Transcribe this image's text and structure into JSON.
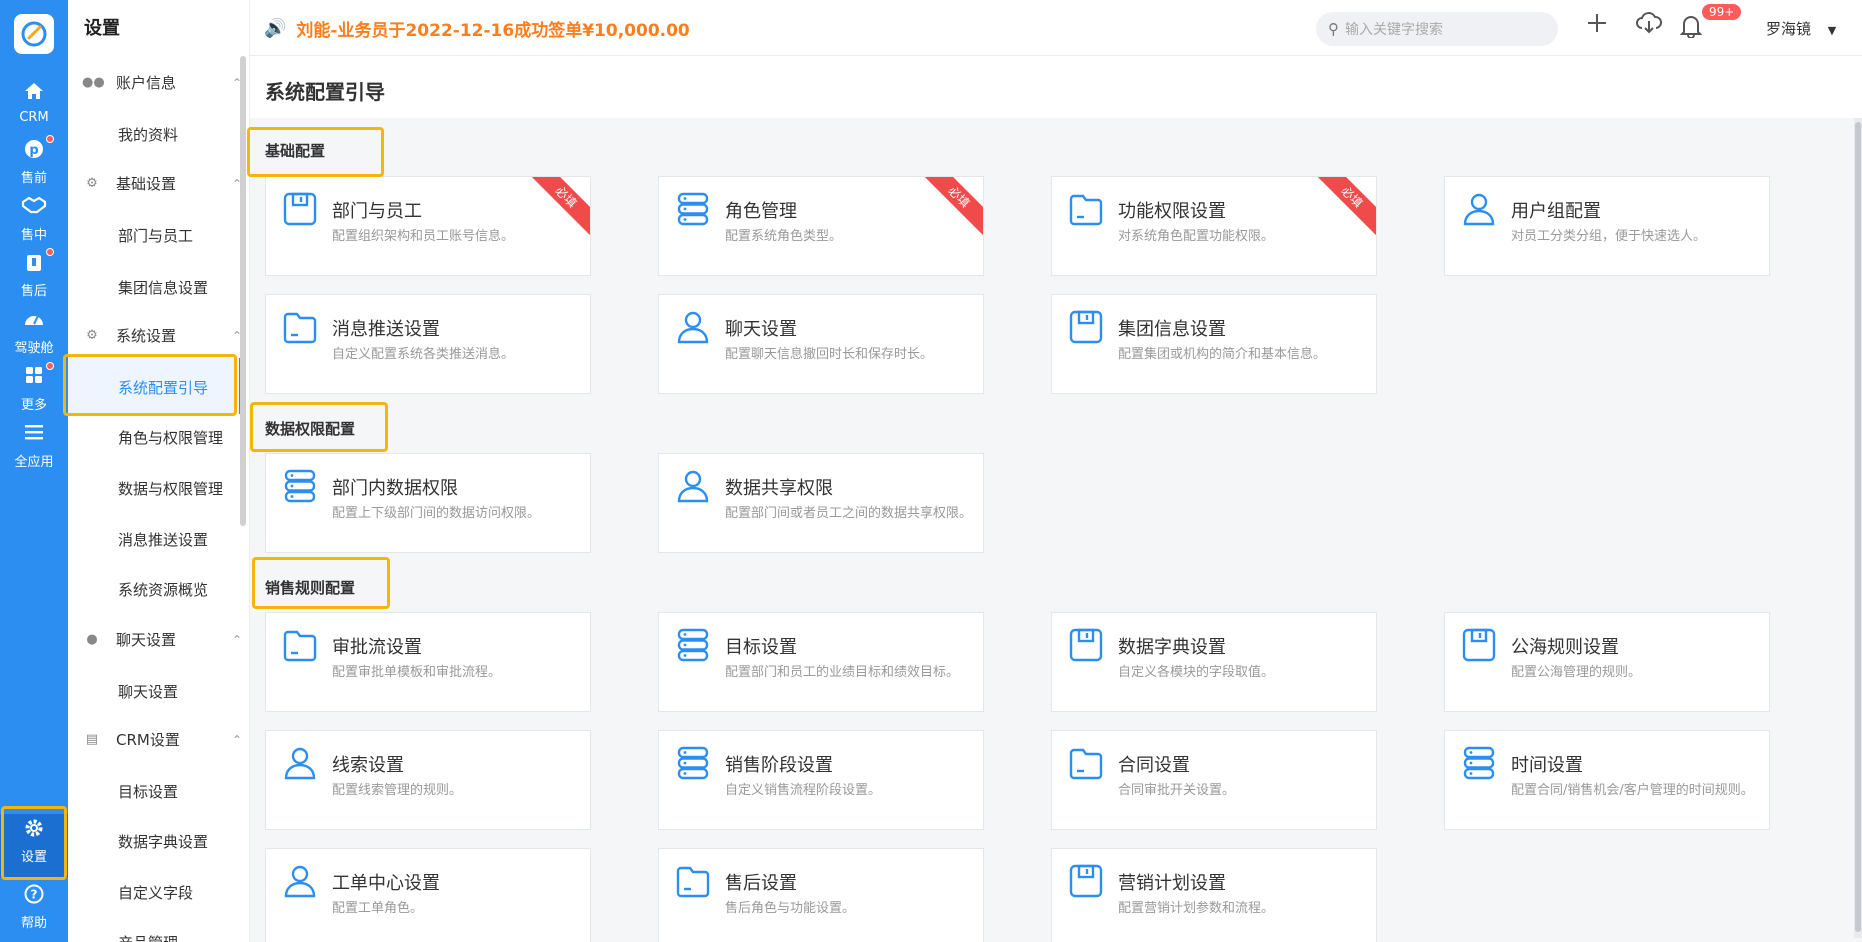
{
  "rail": {
    "items": [
      {
        "label": "CRM",
        "icon": "home-icon",
        "dot": false
      },
      {
        "label": "售前",
        "icon": "pin-icon",
        "dot": true
      },
      {
        "label": "售中",
        "icon": "handshake-icon",
        "dot": false
      },
      {
        "label": "售后",
        "icon": "headset-icon",
        "dot": true
      },
      {
        "label": "驾驶舱",
        "icon": "dashboard-icon",
        "dot": false
      },
      {
        "label": "更多",
        "icon": "grid-icon",
        "dot": true
      },
      {
        "label": "全应用",
        "icon": "menu-icon",
        "dot": false
      },
      {
        "label": "设置",
        "icon": "gear-icon",
        "dot": false
      },
      {
        "label": "帮助",
        "icon": "help-icon",
        "dot": false
      }
    ]
  },
  "sidebar": {
    "title": "设置",
    "groups": {
      "account": "账户信息",
      "basic": "基础设置",
      "system": "系统设置",
      "chat": "聊天设置",
      "crm": "CRM设置"
    },
    "items": {
      "profile": "我的资料",
      "dept": "部门与员工",
      "group_info": "集团信息设置",
      "guide": "系统配置引导",
      "roles": "角色与权限管理",
      "data_perm": "数据与权限管理",
      "push": "消息推送设置",
      "resources": "系统资源概览",
      "chat_set": "聊天设置",
      "target": "目标设置",
      "dict": "数据字典设置",
      "custom_field": "自定义字段",
      "product": "产品管理"
    }
  },
  "header": {
    "notice": "刘能-业务员于2022-12-16成功签单¥10,000.00",
    "search_placeholder": "输入关键字搜索",
    "badge": "99+",
    "user": "罗海镜"
  },
  "main": {
    "title": "系统配置引导",
    "required_label": "必填",
    "sections": {
      "basic": "基础配置",
      "data": "数据权限配置",
      "sales": "销售规则配置"
    },
    "cards": [
      {
        "title": "部门与员工",
        "desc": "配置组织架构和员工账号信息。",
        "icon": "save-icon"
      },
      {
        "title": "角色管理",
        "desc": "配置系统角色类型。",
        "icon": "database-icon"
      },
      {
        "title": "功能权限设置",
        "desc": "对系统角色配置功能权限。",
        "icon": "folder-icon"
      },
      {
        "title": "用户组配置",
        "desc": "对员工分类分组，便于快速选人。",
        "icon": "user-icon"
      },
      {
        "title": "消息推送设置",
        "desc": "自定义配置系统各类推送消息。",
        "icon": "folder-icon"
      },
      {
        "title": "聊天设置",
        "desc": "配置聊天信息撤回时长和保存时长。",
        "icon": "user-icon"
      },
      {
        "title": "集团信息设置",
        "desc": "配置集团或机构的简介和基本信息。",
        "icon": "save-icon"
      },
      {
        "title": "部门内数据权限",
        "desc": "配置上下级部门间的数据访问权限。",
        "icon": "database-icon"
      },
      {
        "title": "数据共享权限",
        "desc": "配置部门间或者员工之间的数据共享权限。",
        "icon": "user-icon"
      },
      {
        "title": "审批流设置",
        "desc": "配置审批单模板和审批流程。",
        "icon": "folder-icon"
      },
      {
        "title": "目标设置",
        "desc": "配置部门和员工的业绩目标和绩效目标。",
        "icon": "database-icon"
      },
      {
        "title": "数据字典设置",
        "desc": "自定义各模块的字段取值。",
        "icon": "save-icon"
      },
      {
        "title": "公海规则设置",
        "desc": "配置公海管理的规则。",
        "icon": "save-icon"
      },
      {
        "title": "线索设置",
        "desc": "配置线索管理的规则。",
        "icon": "user-icon"
      },
      {
        "title": "销售阶段设置",
        "desc": "自定义销售流程阶段设置。",
        "icon": "database-icon"
      },
      {
        "title": "合同设置",
        "desc": "合同审批开关设置。",
        "icon": "folder-icon"
      },
      {
        "title": "时间设置",
        "desc": "配置合同/销售机会/客户管理的时间规则。",
        "icon": "database-icon"
      },
      {
        "title": "工单中心设置",
        "desc": "配置工单角色。",
        "icon": "user-icon"
      },
      {
        "title": "售后设置",
        "desc": "售后角色与功能设置。",
        "icon": "folder-icon"
      },
      {
        "title": "营销计划设置",
        "desc": "配置营销计划参数和流程。",
        "icon": "save-icon"
      }
    ]
  }
}
